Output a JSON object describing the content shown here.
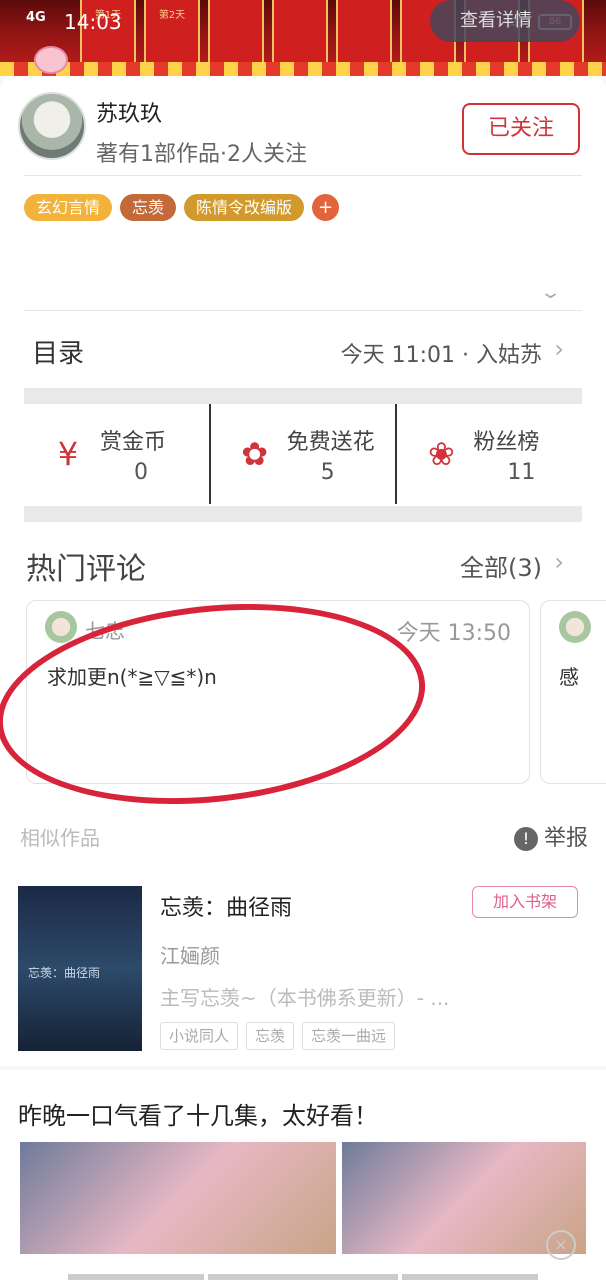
{
  "status_bar": {
    "network": "4G",
    "time": "14:03",
    "battery": "86"
  },
  "banner": {
    "days": [
      "第1天",
      "第2天"
    ],
    "view_detail": "查看详情"
  },
  "author": {
    "name": "苏玖玖",
    "meta": "著有1部作品·2人关注",
    "follow_label": "已关注"
  },
  "tags": [
    "玄幻言情",
    "忘羡",
    "陈情令改编版"
  ],
  "tag_add": "+",
  "catalog": {
    "title": "目录",
    "latest": "今天 11:01 · 入姑苏"
  },
  "stats": [
    {
      "label": "赏金币",
      "value": "0",
      "icon": "red-envelope-icon"
    },
    {
      "label": "免费送花",
      "value": "5",
      "icon": "flower-icon"
    },
    {
      "label": "粉丝榜",
      "value": "11",
      "icon": "medal-icon"
    }
  ],
  "hot_comments": {
    "title": "热门评论",
    "all_label": "全部(3)",
    "comments": [
      {
        "user": "七忠",
        "time": "今天 13:50",
        "text": "求加更n(*≧▽≦*)n"
      },
      {
        "user": "",
        "time": "",
        "text": "感"
      }
    ]
  },
  "similar_label": "相似作品",
  "report_label": "举报",
  "book": {
    "title": "忘羡：曲径雨",
    "shelf_button": "加入书架",
    "author": "江婳颜",
    "desc": "主写忘羡~（本书佛系更新）- ...",
    "tags": [
      "小说同人",
      "忘羡",
      "忘羡一曲远"
    ],
    "cover_text": "忘羡：曲径雨"
  },
  "ad": {
    "title": "昨晚一口气看了十几集，太好看！",
    "close": "×"
  },
  "colors": {
    "accent_red": "#d0343a",
    "tag_yellow": "#f3b23a",
    "tag_brown": "#c26a3a",
    "tag_gold": "#d29a2c"
  }
}
